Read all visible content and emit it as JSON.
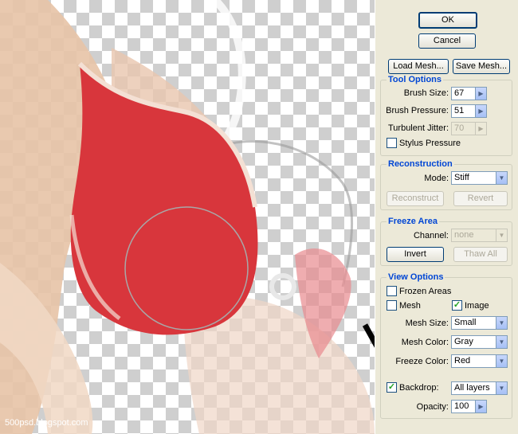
{
  "buttons": {
    "ok": "OK",
    "cancel": "Cancel",
    "load_mesh": "Load Mesh...",
    "save_mesh": "Save Mesh..."
  },
  "tool_options": {
    "title": "Tool Options",
    "brush_size_label": "Brush Size:",
    "brush_size": "67",
    "brush_pressure_label": "Brush Pressure:",
    "brush_pressure": "51",
    "turbulent_jitter_label": "Turbulent Jitter:",
    "turbulent_jitter": "70",
    "stylus_pressure_label": "Stylus Pressure",
    "stylus_pressure_checked": false
  },
  "reconstruction": {
    "title": "Reconstruction",
    "mode_label": "Mode:",
    "mode": "Stiff",
    "reconstruct": "Reconstruct",
    "revert": "Revert"
  },
  "freeze_area": {
    "title": "Freeze Area",
    "channel_label": "Channel:",
    "channel": "none",
    "invert": "Invert",
    "thaw_all": "Thaw All"
  },
  "view_options": {
    "title": "View Options",
    "frozen_areas_label": "Frozen Areas",
    "frozen_areas_checked": false,
    "mesh_label": "Mesh",
    "mesh_checked": false,
    "image_label": "Image",
    "image_checked": true,
    "mesh_size_label": "Mesh Size:",
    "mesh_size": "Small",
    "mesh_color_label": "Mesh Color:",
    "mesh_color": "Gray",
    "freeze_color_label": "Freeze Color:",
    "freeze_color": "Red",
    "backdrop_label": "Backdrop:",
    "backdrop_checked": true,
    "backdrop": "All layers",
    "opacity_label": "Opacity:",
    "opacity": "100"
  },
  "canvas": {
    "watermark": "500psd.blogspot.com"
  },
  "colors": {
    "group_title": "#0046d5",
    "panel_bg": "#ece9d8",
    "garment_red": "#d8363c"
  }
}
